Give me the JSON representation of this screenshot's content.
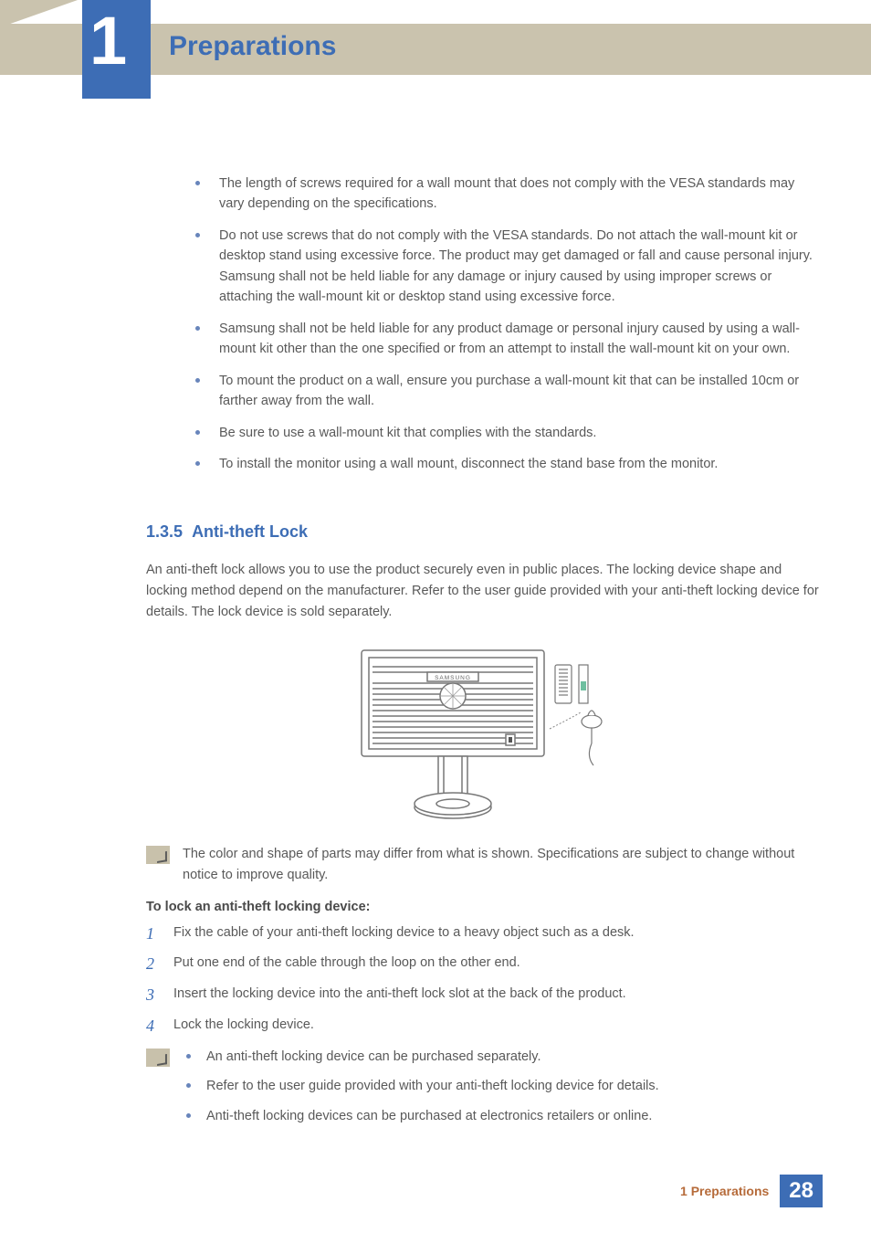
{
  "header": {
    "chapter_number": "1",
    "chapter_title": "Preparations"
  },
  "top_bullets": [
    "The length of screws required for a wall mount that does not comply with the VESA standards may vary depending on the specifications.",
    "Do not use screws that do not comply with the VESA standards. Do not attach the wall-mount kit or desktop stand using excessive force. The product may get damaged or fall and cause personal injury. Samsung shall not be held liable for any damage or injury caused by using improper screws or attaching the wall-mount kit or desktop stand using excessive force.",
    "Samsung shall not be held liable for any product damage or personal injury caused by using a wall-mount kit other than the one specified or from an attempt to install the wall-mount kit on your own.",
    "To mount the product on a wall, ensure you purchase a wall-mount kit that can be installed 10cm or farther away from the wall.",
    "Be sure to use a wall-mount kit that complies with the standards.",
    "To install the monitor using a wall mount, disconnect the stand base from the monitor."
  ],
  "section": {
    "number": "1.3.5",
    "title": "Anti-theft Lock",
    "intro": "An anti-theft lock allows you to use the product securely even in public places. The locking device shape and locking method depend on the manufacturer. Refer to the user guide provided with your anti-theft locking device for details. The lock device is sold separately.",
    "figure_brand": "SAMSUNG",
    "note1": "The color and shape of parts may differ from what is shown. Specifications are subject to change without notice to improve quality.",
    "howto_title": "To lock an anti-theft locking device:",
    "steps": [
      "Fix the cable of your anti-theft locking device to a heavy object such as a desk.",
      "Put one end of the cable through the loop on the other end.",
      "Insert the locking device into the anti-theft lock slot at the back of the product.",
      "Lock the locking device."
    ],
    "note2_bullets": [
      "An anti-theft locking device can be purchased separately.",
      "Refer to the user guide provided with your anti-theft locking device for details.",
      "Anti-theft locking devices can be purchased at electronics retailers or online."
    ]
  },
  "footer": {
    "crumb": "1 Preparations",
    "page": "28"
  }
}
